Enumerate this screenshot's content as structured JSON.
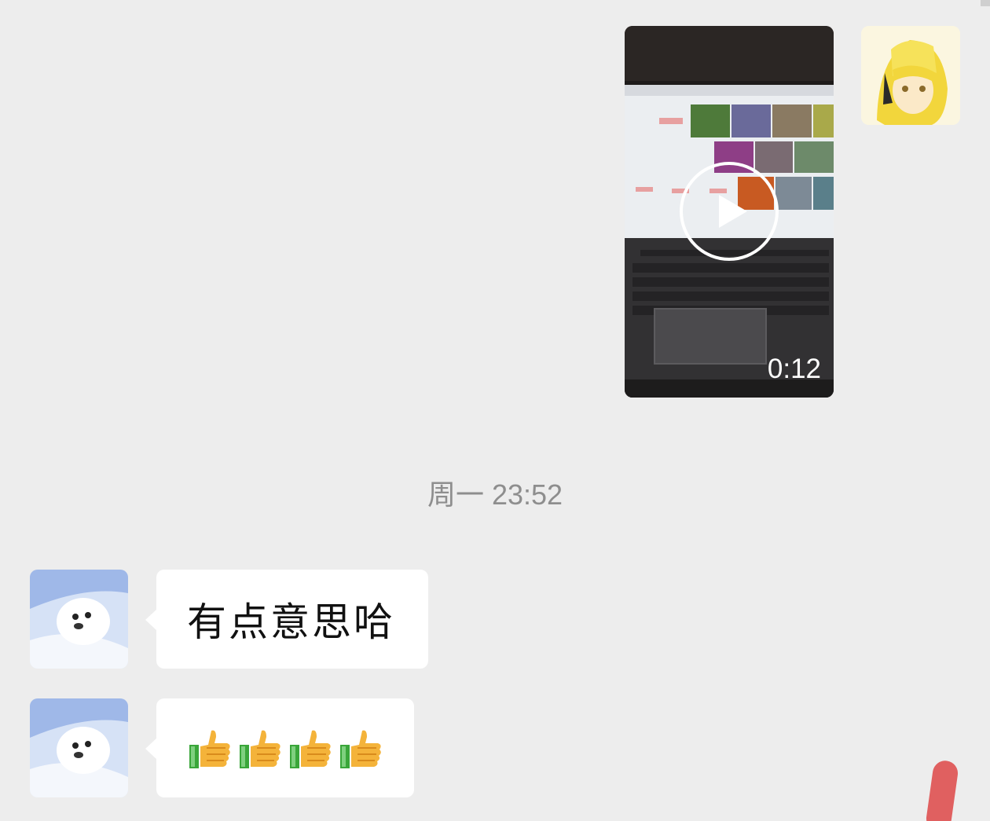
{
  "messages": {
    "video": {
      "duration": "0:12"
    },
    "timestamp": "周一 23:52",
    "text_1": "有点意思哈",
    "emoji_message": {
      "icons": [
        "thumbs-up-icon",
        "thumbs-up-icon",
        "thumbs-up-icon",
        "thumbs-up-icon"
      ]
    }
  },
  "colors": {
    "background": "#ededed",
    "bubble": "#ffffff",
    "timestamp_text": "#8e8e8e"
  }
}
